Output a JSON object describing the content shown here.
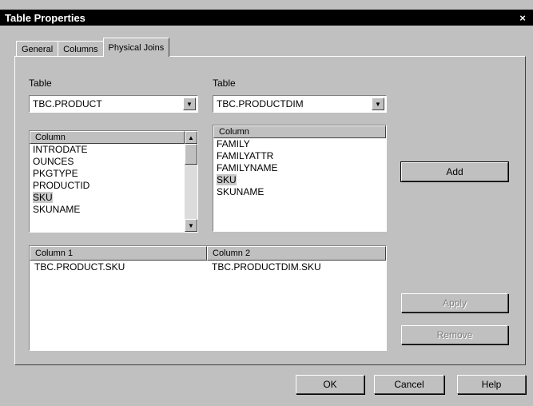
{
  "window": {
    "title": "Table Properties",
    "close_glyph": "×"
  },
  "tabs": [
    {
      "label": "General",
      "active": false
    },
    {
      "label": "Columns",
      "active": false
    },
    {
      "label": "Physical Joins",
      "active": true
    }
  ],
  "left": {
    "table_label": "Table",
    "table_value": "TBC.PRODUCT",
    "list_header": "Column",
    "items": [
      "INTRODATE",
      "OUNCES",
      "PKGTYPE",
      "PRODUCTID",
      "SKU",
      "SKUNAME"
    ],
    "selected_index": 4
  },
  "right": {
    "table_label": "Table",
    "table_value": "TBC.PRODUCTDIM",
    "list_header": "Column",
    "items": [
      "FAMILY",
      "FAMILYATTR",
      "FAMILYNAME",
      "SKU",
      "SKUNAME"
    ],
    "selected_index": 3
  },
  "joins": {
    "columns": [
      "Column 1",
      "Column 2"
    ],
    "rows": [
      [
        "TBC.PRODUCT.SKU",
        "TBC.PRODUCTDIM.SKU"
      ]
    ]
  },
  "buttons": {
    "add": "Add",
    "apply": "Apply",
    "remove": "Remove",
    "ok": "OK",
    "cancel": "Cancel",
    "help": "Help"
  },
  "icons": {
    "dropdown": "dropdown-arrow-icon",
    "scroll_up": "scroll-up-arrow-icon",
    "scroll_down": "scroll-down-arrow-icon"
  }
}
